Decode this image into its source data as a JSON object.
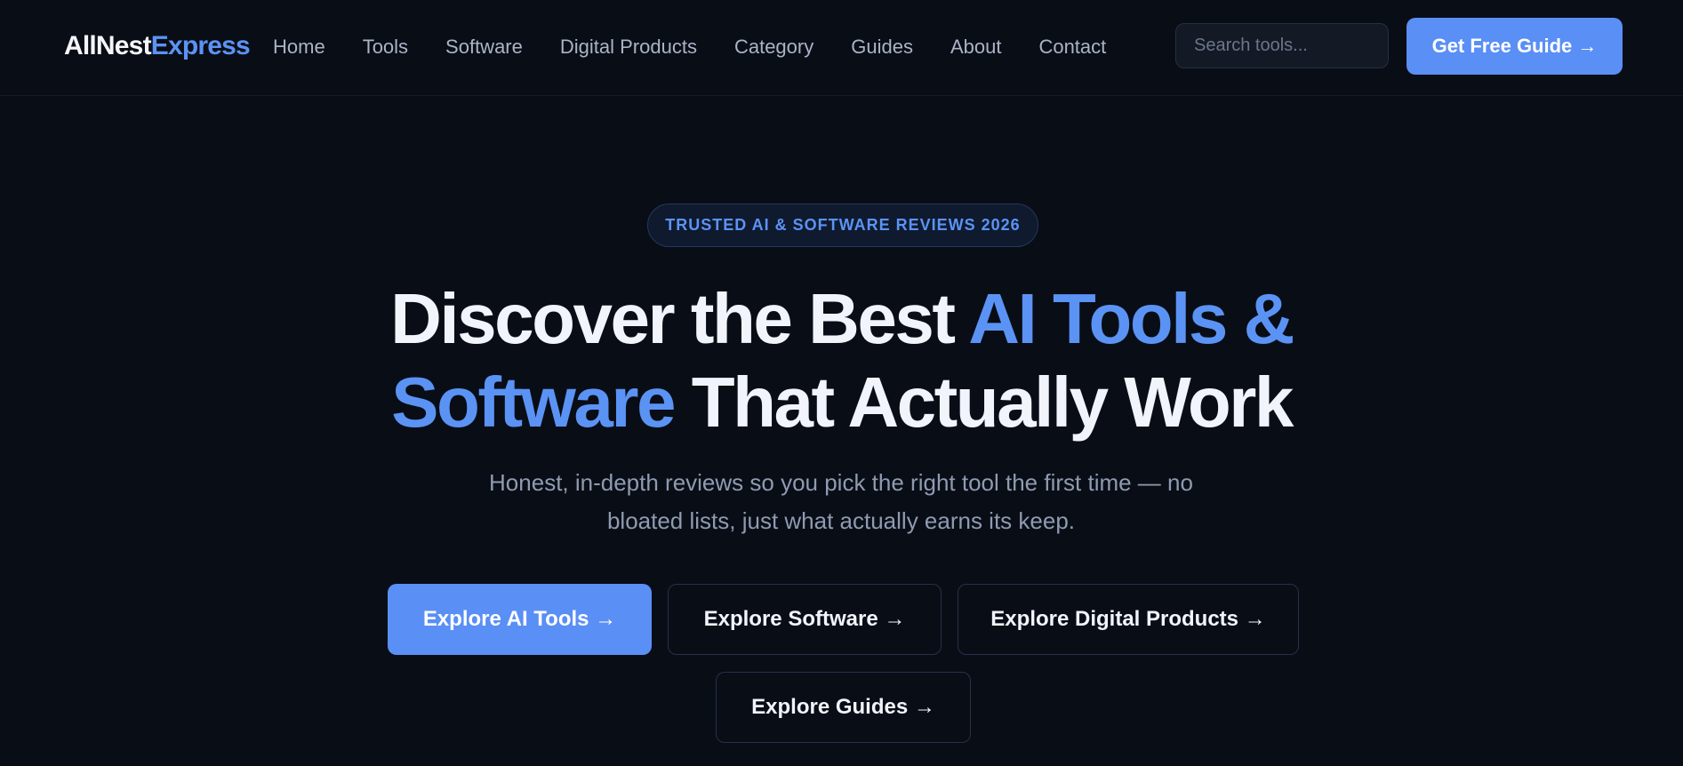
{
  "header": {
    "logo_part_a": "AllNest",
    "logo_part_b": "Express",
    "nav": [
      "Home",
      "Tools",
      "Software",
      "Digital Products",
      "Category",
      "Guides",
      "About",
      "Contact"
    ],
    "search_placeholder": "Search tools...",
    "cta_label": "Get Free Guide →"
  },
  "hero": {
    "badge": "TRUSTED AI & SOFTWARE REVIEWS 2026",
    "headline": {
      "line1_plain": "Discover the Best ",
      "line1_accent": "AI Tools &",
      "line2_accent": "Software",
      "line2_plain": " That Actually Work"
    },
    "subtitle_line1": "Honest, in-depth reviews so you pick the right tool the first time — no",
    "subtitle_line2": "bloated lists, just what actually earns its keep.",
    "buttons": {
      "ai_tools": "Explore AI Tools →",
      "software": "Explore Software →",
      "digital_products": "Explore Digital Products →",
      "guides": "Explore Guides →"
    }
  },
  "colors": {
    "background": "#090d16",
    "accent": "#5a8ff5",
    "text_primary": "#f1f4fa",
    "text_muted": "#8f9bb1"
  }
}
